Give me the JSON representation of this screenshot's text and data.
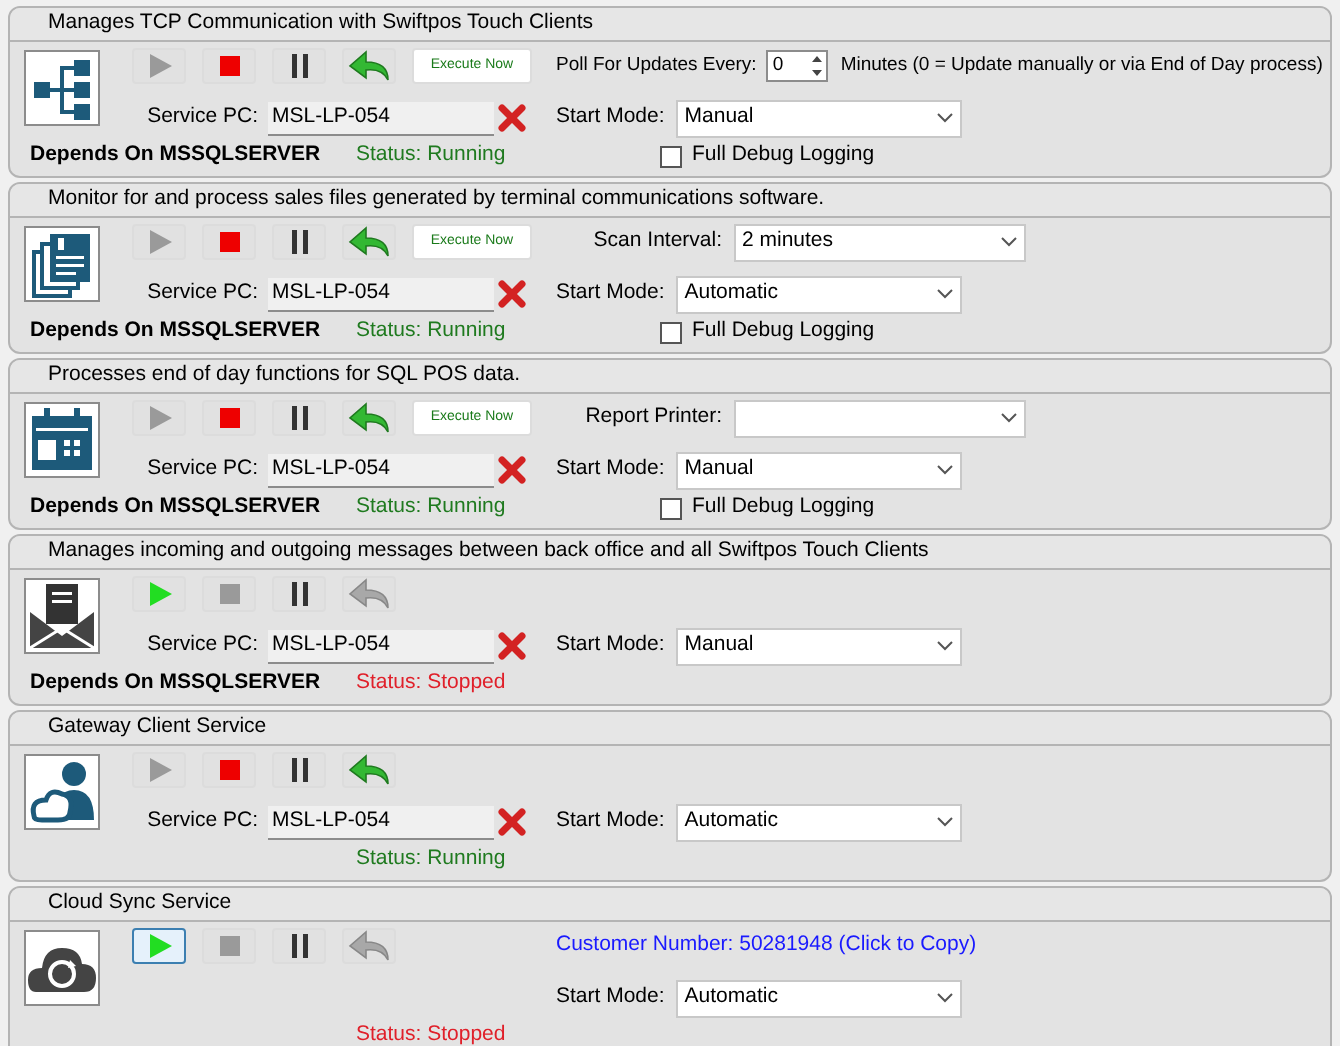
{
  "services": [
    {
      "description": "Manages TCP Communication with Swiftpos Touch Clients",
      "buttons": [
        {
          "kind": "start",
          "enabled": false,
          "focused": false
        },
        {
          "kind": "stop",
          "enabled": true,
          "focused": false
        },
        {
          "kind": "pause",
          "enabled": true,
          "focused": false
        },
        {
          "kind": "restart",
          "enabled": true,
          "focused": false
        }
      ],
      "execute_now": "Execute Now",
      "option": {
        "kind": "spinner",
        "label": "Poll For Updates Every:",
        "value": "0",
        "note": "Minutes (0 = Update manually or via End of Day process)"
      },
      "service_pc_label": "Service PC:",
      "service_pc": "MSL-LP-054",
      "start_mode_label": "Start Mode:",
      "start_mode": "Manual",
      "depends_on": "Depends On MSSQLSERVER",
      "status": "Status: Running",
      "color": "#1f7a1f",
      "debug_logging": {
        "label": "Full Debug Logging",
        "checked": false
      }
    },
    {
      "description": "Monitor for and process sales files generated by terminal communications software.",
      "buttons": [
        {
          "kind": "start",
          "enabled": false,
          "focused": false
        },
        {
          "kind": "stop",
          "enabled": true,
          "focused": false
        },
        {
          "kind": "pause",
          "enabled": true,
          "focused": false
        },
        {
          "kind": "restart",
          "enabled": true,
          "focused": false
        }
      ],
      "execute_now": "Execute Now",
      "option": {
        "kind": "select",
        "label": "Scan Interval:",
        "value": "2 minutes"
      },
      "service_pc_label": "Service PC:",
      "service_pc": "MSL-LP-054",
      "start_mode_label": "Start Mode:",
      "start_mode": "Automatic",
      "depends_on": "Depends On MSSQLSERVER",
      "status": "Status: Running",
      "color": "#1f7a1f",
      "debug_logging": {
        "label": "Full Debug Logging",
        "checked": false
      }
    },
    {
      "description": "Processes end of day functions for SQL POS data.",
      "buttons": [
        {
          "kind": "start",
          "enabled": false,
          "focused": false
        },
        {
          "kind": "stop",
          "enabled": true,
          "focused": false
        },
        {
          "kind": "pause",
          "enabled": true,
          "focused": false
        },
        {
          "kind": "restart",
          "enabled": true,
          "focused": false
        }
      ],
      "execute_now": "Execute Now",
      "option": {
        "kind": "select",
        "label": "Report Printer:"
      },
      "service_pc_label": "Service PC:",
      "service_pc": "MSL-LP-054",
      "start_mode_label": "Start Mode:",
      "start_mode": "Manual",
      "depends_on": "Depends On MSSQLSERVER",
      "status": "Status: Running",
      "color": "#1f7a1f",
      "debug_logging": {
        "label": "Full Debug Logging",
        "checked": false
      }
    },
    {
      "description": "Manages incoming and outgoing messages between back office and all Swiftpos Touch Clients",
      "buttons": [
        {
          "kind": "start",
          "enabled": true,
          "focused": false
        },
        {
          "kind": "stop",
          "enabled": false,
          "focused": false
        },
        {
          "kind": "pause",
          "enabled": true,
          "focused": false
        },
        {
          "kind": "restart",
          "enabled": false,
          "focused": false
        }
      ],
      "service_pc_label": "Service PC:",
      "service_pc": "MSL-LP-054",
      "start_mode_label": "Start Mode:",
      "start_mode": "Manual",
      "depends_on": "Depends On MSSQLSERVER",
      "status": "Status: Stopped",
      "color": "#e0202a"
    },
    {
      "description": "Gateway Client Service",
      "buttons": [
        {
          "kind": "start",
          "enabled": false,
          "focused": false
        },
        {
          "kind": "stop",
          "enabled": true,
          "focused": false
        },
        {
          "kind": "pause",
          "enabled": true,
          "focused": false
        },
        {
          "kind": "restart",
          "enabled": true,
          "focused": false
        }
      ],
      "service_pc_label": "Service PC:",
      "service_pc": "MSL-LP-054",
      "start_mode_label": "Start Mode:",
      "start_mode": "Automatic",
      "status": "Status: Running",
      "color": "#1f7a1f"
    },
    {
      "description": "Cloud Sync Service",
      "buttons": [
        {
          "kind": "start",
          "enabled": true,
          "focused": true
        },
        {
          "kind": "stop",
          "enabled": false,
          "focused": false
        },
        {
          "kind": "pause",
          "enabled": true,
          "focused": false
        },
        {
          "kind": "restart",
          "enabled": false,
          "focused": false
        }
      ],
      "option": {
        "kind": "link",
        "label": "Customer Number: 50281948 (Click to Copy)"
      },
      "start_mode_label": "Start Mode:",
      "start_mode": "Automatic",
      "status": "Status: Stopped",
      "color": "#e0202a"
    }
  ]
}
